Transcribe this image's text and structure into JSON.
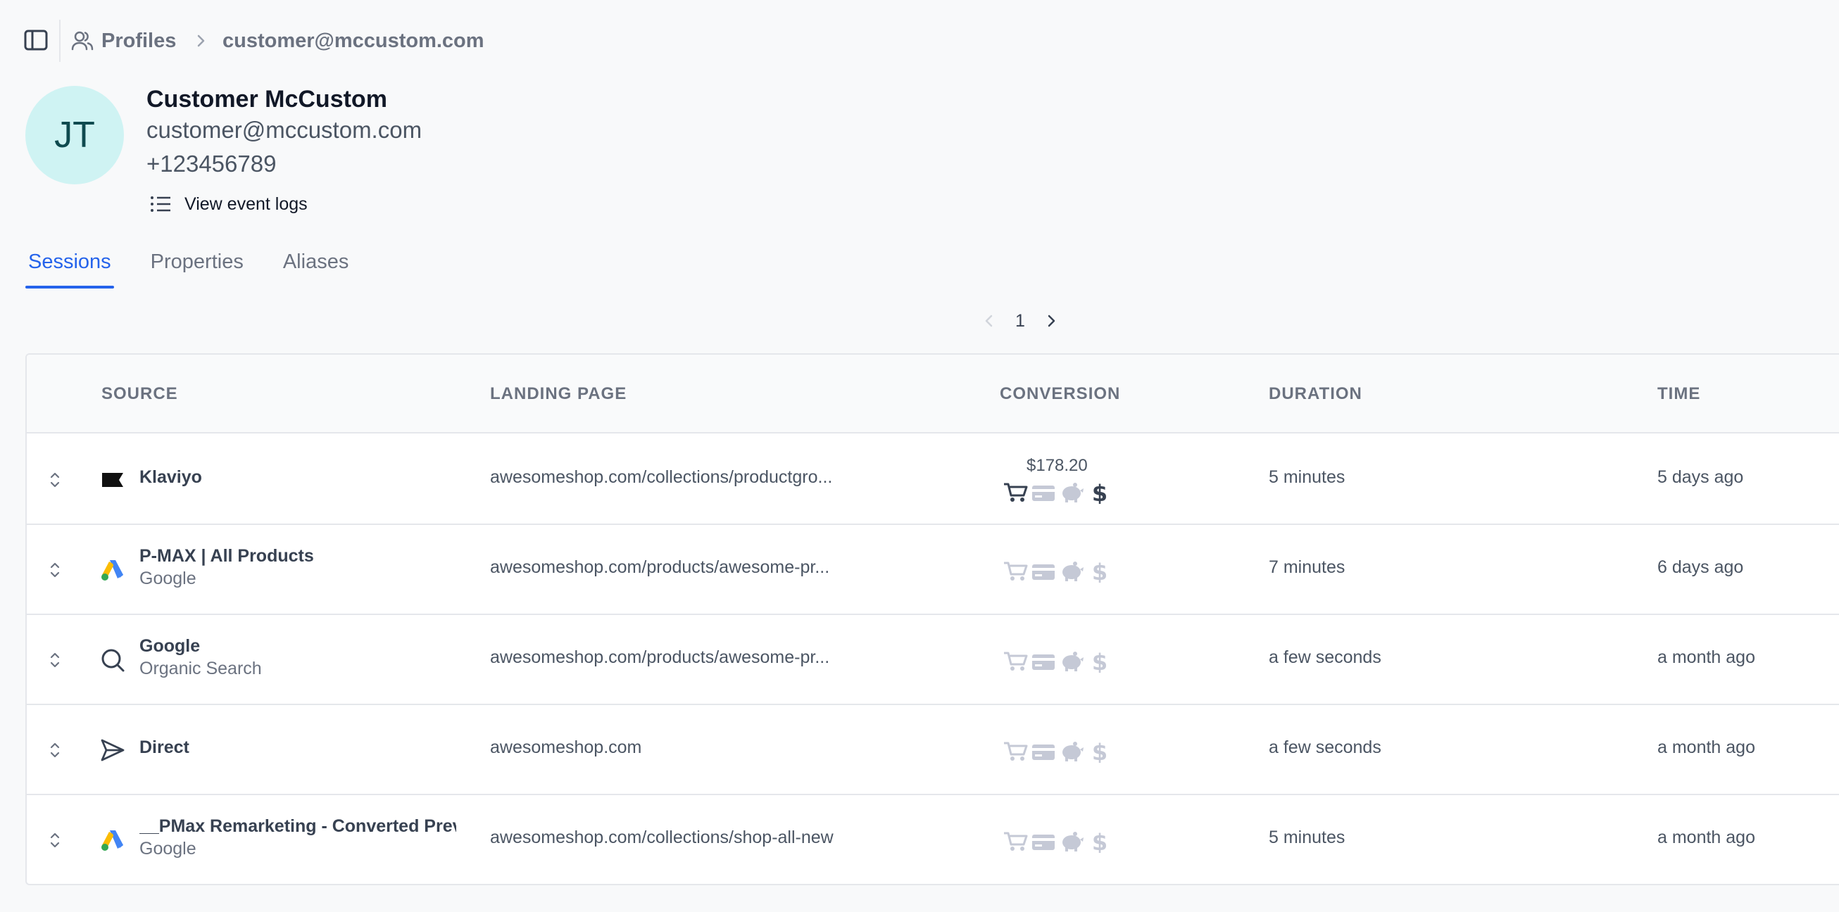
{
  "breadcrumb": {
    "root_label": "Profiles",
    "current_label": "customer@mccustom.com"
  },
  "profile": {
    "initials": "JT",
    "name": "Customer McCustom",
    "email": "customer@mccustom.com",
    "phone": "+123456789",
    "view_logs_label": "View event logs"
  },
  "tabs": [
    {
      "label": "Sessions",
      "active": true
    },
    {
      "label": "Properties",
      "active": false
    },
    {
      "label": "Aliases",
      "active": false
    }
  ],
  "pagination": {
    "current_page": "1"
  },
  "table": {
    "headers": {
      "source": "SOURCE",
      "landing_page": "LANDING PAGE",
      "conversion": "CONVERSION",
      "duration": "DURATION",
      "time": "TIME"
    },
    "rows": [
      {
        "source_icon": "klaviyo-flag-icon",
        "source_name": "Klaviyo",
        "source_sub": "",
        "landing_page": "awesomeshop.com/collections/productgro...",
        "conversion_value": "$178.20",
        "conversion_active": [
          true,
          false,
          false,
          true
        ],
        "duration": "5 minutes",
        "time": "5 days ago"
      },
      {
        "source_icon": "google-ads-icon",
        "source_name": "P-MAX | All Products",
        "source_sub": "Google",
        "landing_page": "awesomeshop.com/products/awesome-pr...",
        "conversion_value": "",
        "conversion_active": [
          false,
          false,
          false,
          false
        ],
        "duration": "7 minutes",
        "time": "6 days ago"
      },
      {
        "source_icon": "search-icon",
        "source_name": "Google",
        "source_sub": "Organic Search",
        "landing_page": "awesomeshop.com/products/awesome-pr...",
        "conversion_value": "",
        "conversion_active": [
          false,
          false,
          false,
          false
        ],
        "duration": "a few seconds",
        "time": "a month ago"
      },
      {
        "source_icon": "send-icon",
        "source_name": "Direct",
        "source_sub": "",
        "landing_page": "awesomeshop.com",
        "conversion_value": "",
        "conversion_active": [
          false,
          false,
          false,
          false
        ],
        "duration": "a few seconds",
        "time": "a month ago"
      },
      {
        "source_icon": "google-ads-icon",
        "source_name": "__PMax Remarketing - Converted Prev",
        "source_sub": "Google",
        "landing_page": "awesomeshop.com/collections/shop-all-new",
        "conversion_value": "",
        "conversion_active": [
          false,
          false,
          false,
          false
        ],
        "duration": "5 minutes",
        "time": "a month ago"
      }
    ]
  },
  "colors": {
    "accent": "#2563eb",
    "icon_active": "#374151",
    "icon_inactive": "#c5c9d6",
    "avatar_bg": "#cff3f3"
  }
}
